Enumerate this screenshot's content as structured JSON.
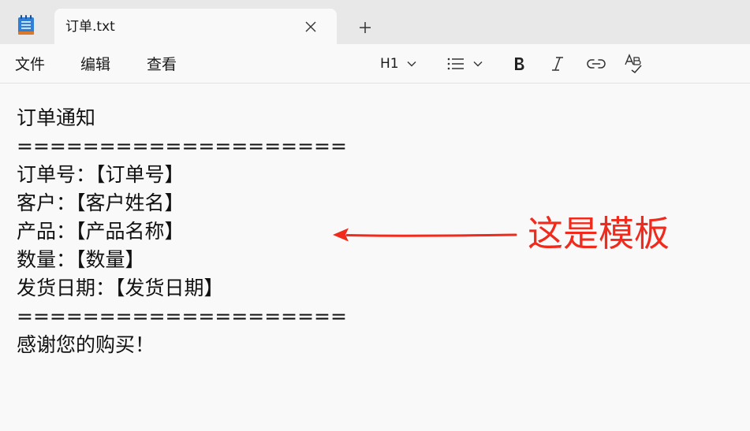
{
  "tab": {
    "title": "订单.txt"
  },
  "menu": {
    "file": "文件",
    "edit": "编辑",
    "view": "查看"
  },
  "toolbar": {
    "heading": "H1"
  },
  "document": {
    "lines": [
      "订单通知",
      "====================",
      "订单号：【订单号】",
      "客户：【客户姓名】",
      "产品：【产品名称】",
      "数量：【数量】",
      "发货日期：【发货日期】",
      "====================",
      "感谢您的购买！"
    ]
  },
  "annotation": {
    "text": "这是模板",
    "color": "#f02a1c"
  },
  "icons": {
    "app": "notepad-icon",
    "close": "close-icon",
    "new_tab": "plus-icon",
    "heading_dropdown": "chevron-down-icon",
    "list": "bulleted-list-icon",
    "bold": "bold-icon",
    "italic": "italic-icon",
    "link": "link-icon",
    "spellcheck": "spellcheck-icon"
  }
}
